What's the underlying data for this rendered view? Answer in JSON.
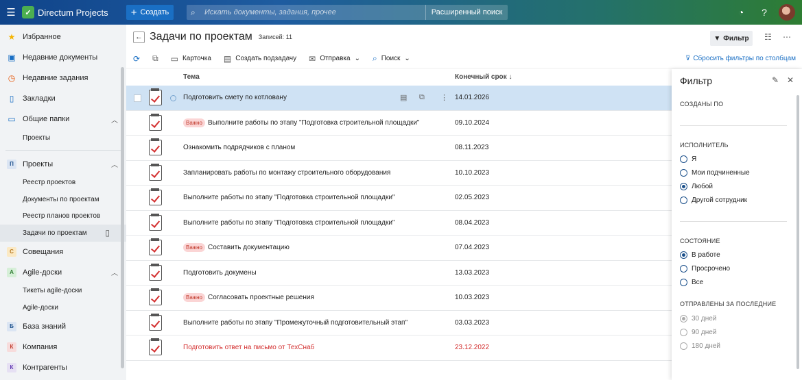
{
  "app": {
    "name": "Directum Projects",
    "create_label": "Создать",
    "search_placeholder": "Искать документы, задания, прочее",
    "advanced_search": "Расширенный поиск"
  },
  "sidebar": {
    "favorites": "Избранное",
    "recent_docs": "Недавние документы",
    "recent_tasks": "Недавние задания",
    "bookmarks": "Закладки",
    "shared_folders": "Общие папки",
    "shared_sub": [
      "Проекты"
    ],
    "projects": {
      "badge": "П",
      "label": "Проекты",
      "sub": [
        "Реестр проектов",
        "Документы по проектам",
        "Реестр планов проектов",
        "Задачи по проектам"
      ]
    },
    "meetings": {
      "badge": "С",
      "label": "Совещания"
    },
    "agile": {
      "badge": "А",
      "label": "Agile-доски",
      "sub": [
        "Тикеты agile-доски",
        "Agile-доски"
      ]
    },
    "knowledge": {
      "badge": "Б",
      "label": "База знаний"
    },
    "company": {
      "badge": "К",
      "label": "Компания"
    },
    "contractors": {
      "badge": "К",
      "label": "Контрагенты"
    }
  },
  "page": {
    "title": "Задачи по проектам",
    "count": "Записей: 11",
    "filter_label": "Фильтр"
  },
  "toolbar": {
    "card": "Карточка",
    "create_subtask": "Создать подзадачу",
    "send": "Отправка",
    "search": "Поиск",
    "reset_filters": "Сбросить фильтры по столбцам"
  },
  "columns": {
    "subject": "Тема",
    "deadline": "Конечный срок"
  },
  "important_label": "Важно",
  "rows": [
    {
      "subject": "Подготовить смету по котловану",
      "date": "14.01.2026",
      "important": false,
      "overdue": false,
      "selected": true
    },
    {
      "subject": "Выполните работы по этапу \"Подготовка строительной площадки\"",
      "date": "09.10.2024",
      "important": true,
      "overdue": false
    },
    {
      "subject": "Ознакомить подрядчиков с планом",
      "date": "08.11.2023",
      "important": false,
      "overdue": false
    },
    {
      "subject": "Запланировать работы по монтажу строительного оборудования",
      "date": "10.10.2023",
      "important": false,
      "overdue": false
    },
    {
      "subject": "Выполните работы по этапу \"Подготовка строительной площадки\"",
      "date": "02.05.2023",
      "important": false,
      "overdue": false
    },
    {
      "subject": "Выполните работы по этапу \"Подготовка строительной площадки\"",
      "date": "08.04.2023",
      "important": false,
      "overdue": false
    },
    {
      "subject": "Составить документацию",
      "date": "07.04.2023",
      "important": true,
      "overdue": false
    },
    {
      "subject": "Подготовить докумены",
      "date": "13.03.2023",
      "important": false,
      "overdue": false
    },
    {
      "subject": "Согласовать проектные решения",
      "date": "10.03.2023",
      "important": true,
      "overdue": false
    },
    {
      "subject": "Выполните работы по этапу \"Промежуточный подготовительный этап\"",
      "date": "03.03.2023",
      "important": false,
      "overdue": false
    },
    {
      "subject": "Подготовить ответ на письмо от ТехСнаб",
      "date": "23.12.2022",
      "important": false,
      "overdue": true
    }
  ],
  "filter": {
    "title": "Фильтр",
    "created_by": "СОЗДАНЫ ПО",
    "executor": {
      "label": "ИСПОЛНИТЕЛЬ",
      "options": [
        "Я",
        "Мои подчиненные",
        "Любой",
        "Другой сотрудник"
      ],
      "selected": 2
    },
    "state": {
      "label": "СОСТОЯНИЕ",
      "options": [
        "В работе",
        "Просрочено",
        "Все"
      ],
      "selected": 0
    },
    "sent": {
      "label": "ОТПРАВЛЕНЫ ЗА ПОСЛЕДНИЕ",
      "options": [
        "30 дней",
        "90 дней",
        "180 дней"
      ],
      "selected": 0
    }
  },
  "colors": {
    "accent": "#1a6fc4",
    "overdue": "#d32f2f",
    "selected_row": "#cfe2f4"
  }
}
